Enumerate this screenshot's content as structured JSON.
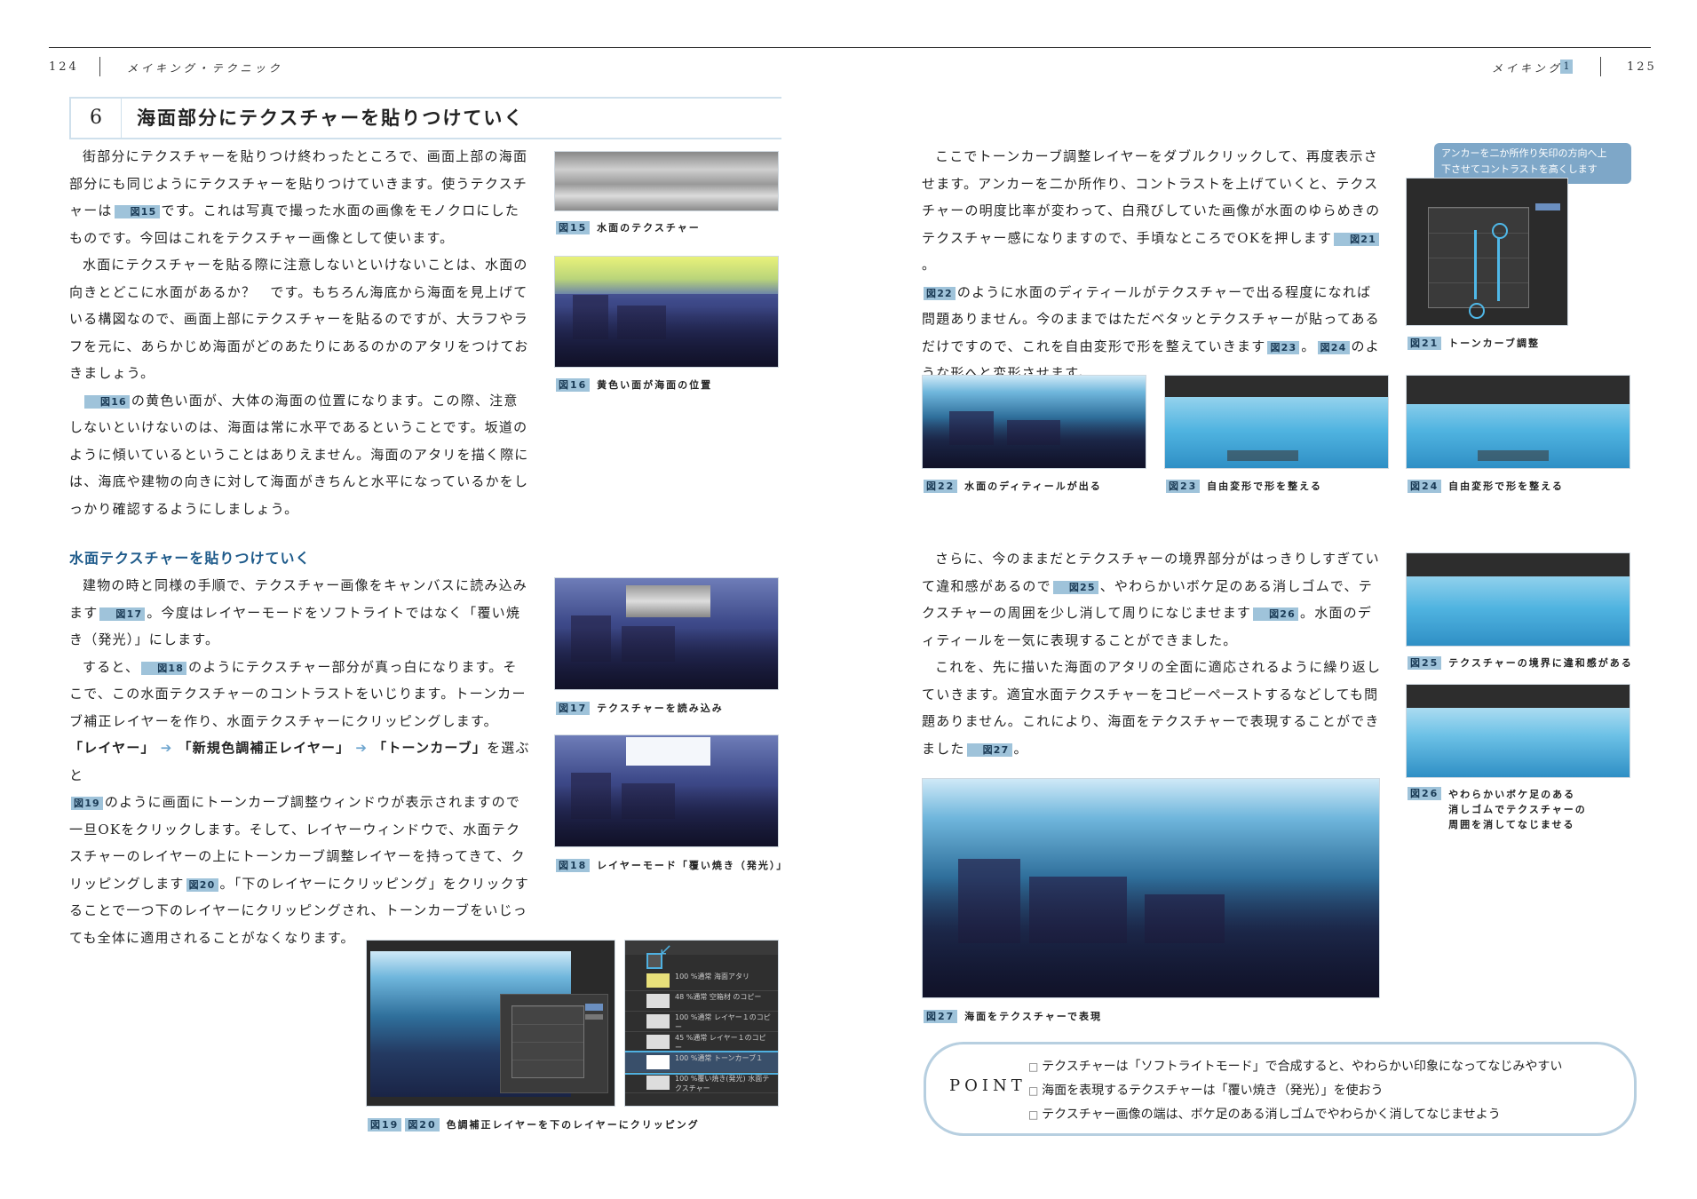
{
  "header": {
    "left_page": "124",
    "left_section": "メイキング・テクニック",
    "right_section": "メイキング",
    "right_chapter": "1",
    "right_page": "125"
  },
  "section": {
    "number": "6",
    "title": "海面部分にテクスチャーを貼りつけていく"
  },
  "left_col": {
    "p1": "街部分にテクスチャーを貼りつけ終わったところで、画面上部の海面部分にも同じようにテクスチャーを貼りつけていきます。使うテクスチャーは",
    "p1_ref": "図15",
    "p1b": "です。これは写真で撮った水面の画像をモノクロにしたものです。今回はこれをテクスチャー画像として使います。",
    "p2": "水面にテクスチャーを貼る際に注意しないといけないことは、水面の向きとどこに水面があるか？　です。もちろん海底から海面を見上げている構図なので、画面上部にテクスチャーを貼るのですが、大ラフやラフを元に、あらかじめ海面がどのあたりにあるのかのアタリをつけておきましょう。",
    "p3_ref": "図16",
    "p3": "の黄色い面が、大体の海面の位置になります。この際、注意しないといけないのは、海面は常に水平であるということです。坂道のように傾いているということはありえません。海面のアタリを描く際には、海底や建物の向きに対して海面がきちんと水平になっているかをしっかり確認するようにしましょう。",
    "subheading": "水面テクスチャーを貼りつけていく",
    "p4a": "建物の時と同様の手順で、テクスチャー画像をキャンバスに読み込みます",
    "p4_ref": "図17",
    "p4b": "。今度はレイヤーモードをソフトライトではなく「覆い焼き（発光）」にします。",
    "p5a": "すると、",
    "p5_ref": "図18",
    "p5b": "のようにテクスチャー部分が真っ白になります。そこで、この水面テクスチャーのコントラストをいじります。トーンカーブ補正レイヤーを作り、水面テクスチャーにクリッピングします。",
    "menu1": "「レイヤー」",
    "menu2": "「新規色調補正レイヤー」",
    "menu3": "「トーンカーブ」",
    "menu_tail": "を選ぶと",
    "p6_ref": "図19",
    "p6a": "のように画面にトーンカーブ調整ウィンドウが表示されますので一旦OKをクリックします。そして、レイヤーウィンドウで、水面テクスチャーのレイヤーの上にトーンカーブ調整レイヤーを持ってきて、クリッピングします",
    "p6_ref2": "図20",
    "p6b": "。「下のレイヤーにクリッピング」をクリックすることで一つ下のレイヤーにクリッピングされ、トーンカーブをいじっても全体に適用されることがなくなります。"
  },
  "right_col": {
    "p1": "ここでトーンカーブ調整レイヤーをダブルクリックして、再度表示させます。アンカーを二か所作り、コントラストを上げていくと、テクスチャーの明度比率が変わって、白飛びしていた画像が水面のゆらめきのテクスチャー感になりますので、手頃なところでOKを押します",
    "p1_ref": "図21",
    "p2_ref": "図22",
    "p2": "のように水面のディティールがテクスチャーで出る程度になれば問題ありません。今のままではただベタッとテクスチャーが貼ってあるだけですので、これを自由変形で形を整えていきます",
    "p2_ref2": "図23",
    "p2_ref3": "図24",
    "p2b": "のような形へと変形させます。",
    "p3a": "さらに、今のままだとテクスチャーの境界部分がはっきりしすぎていて違和感があるので",
    "p3_ref": "図25",
    "p3b": "、やわらかいボケ足のある消しゴムで、テクスチャーの周囲を少し消して周りになじませます",
    "p3_ref2": "図26",
    "p3c": "。水面のディティールを一気に表現することができました。",
    "p4": "これを、先に描いた海面のアタリの全面に適応されるように繰り返していきます。適宜水面テクスチャーをコピーペーストするなどしても問題ありません。これにより、海面をテクスチャーで表現することができました",
    "p4_ref": "図27"
  },
  "captions": {
    "fig15": {
      "num": "図15",
      "text": "水面のテクスチャー"
    },
    "fig16": {
      "num": "図16",
      "text": "黄色い面が海面の位置"
    },
    "fig17": {
      "num": "図17",
      "text": "テクスチャーを読み込み"
    },
    "fig18": {
      "num": "図18",
      "text": "レイヤーモード「覆い焼き（発光）」"
    },
    "fig1920": {
      "num1": "図19",
      "num2": "図20",
      "text": "色調補正レイヤーを下のレイヤーにクリッピング"
    },
    "fig21": {
      "num": "図21",
      "text": "トーンカーブ調整"
    },
    "fig22": {
      "num": "図22",
      "text": "水面のディティールが出る"
    },
    "fig23": {
      "num": "図23",
      "text": "自由変形で形を整える"
    },
    "fig24": {
      "num": "図24",
      "text": "自由変形で形を整える"
    },
    "fig25": {
      "num": "図25",
      "text": "テクスチャーの境界に違和感がある"
    },
    "fig26": {
      "num": "図26",
      "line1": "やわらかいボケ足のある",
      "line2": "消しゴムでテクスチャーの",
      "line3": "周囲を消してなじませる"
    },
    "fig27": {
      "num": "図27",
      "text": "海面をテクスチャーで表現"
    }
  },
  "callout": {
    "line1": "アンカーを二か所作り矢印の方向へ上",
    "line2": "下させてコントラストを高くします"
  },
  "point": {
    "label": "POINT",
    "items": [
      "テクスチャーは「ソフトライトモード」で合成すると、やわらかい印象になってなじみやすい",
      "海面を表現するテクスチャーは「覆い焼き（発光）」を使おう",
      "テクスチャー画像の端は、ボケ足のある消しゴムでやわらかく消してなじませよう"
    ]
  },
  "layer_panel": {
    "rows": [
      "100 %通常 海面アタリ",
      "48 %通常 空箱材 のコピー",
      "100 %通常 レイヤー１のコピー",
      "45 %通常 レイヤー１のコピー",
      "100 %通常 トーンカーブ１",
      "100 %覆い焼き(発光) 水面テクスチャー"
    ]
  }
}
